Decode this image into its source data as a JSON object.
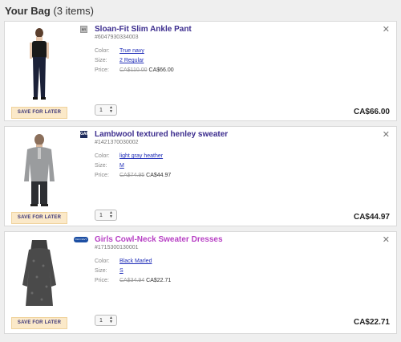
{
  "bag": {
    "title": "Your Bag",
    "count": "(3 items)"
  },
  "save_label": "SAVE FOR LATER",
  "labels": {
    "color": "Color:",
    "size": "Size:",
    "price": "Price:"
  },
  "close_glyph": "✕",
  "items": [
    {
      "brand": "banana-republic",
      "brand_mark": "BR",
      "name": "Sloan-Fit Slim Ankle Pant",
      "name_color": "#3c2d8e",
      "sku": "#6047930334003",
      "color": "True navy",
      "size": "2 Regular",
      "old_price": "CA$110.00",
      "price": "CA$66.00",
      "qty": "1",
      "total": "CA$66.00"
    },
    {
      "brand": "gap",
      "brand_mark": "GAP",
      "name": "Lambwool textured henley sweater",
      "name_color": "#3c2d8e",
      "sku": "#1421370030002",
      "color": "light gray heather",
      "size": "M",
      "old_price": "CA$74.95",
      "price": "CA$44.97",
      "qty": "1",
      "total": "CA$44.97"
    },
    {
      "brand": "old-navy",
      "brand_mark": "OLD NAVY",
      "name": "Girls Cowl-Neck Sweater Dresses",
      "name_color": "#b73fc4",
      "sku": "#1715300130001",
      "color": "Black Marled",
      "size": "S",
      "old_price": "CA$34.94",
      "price": "CA$22.71",
      "qty": "1",
      "total": "CA$22.71"
    }
  ]
}
